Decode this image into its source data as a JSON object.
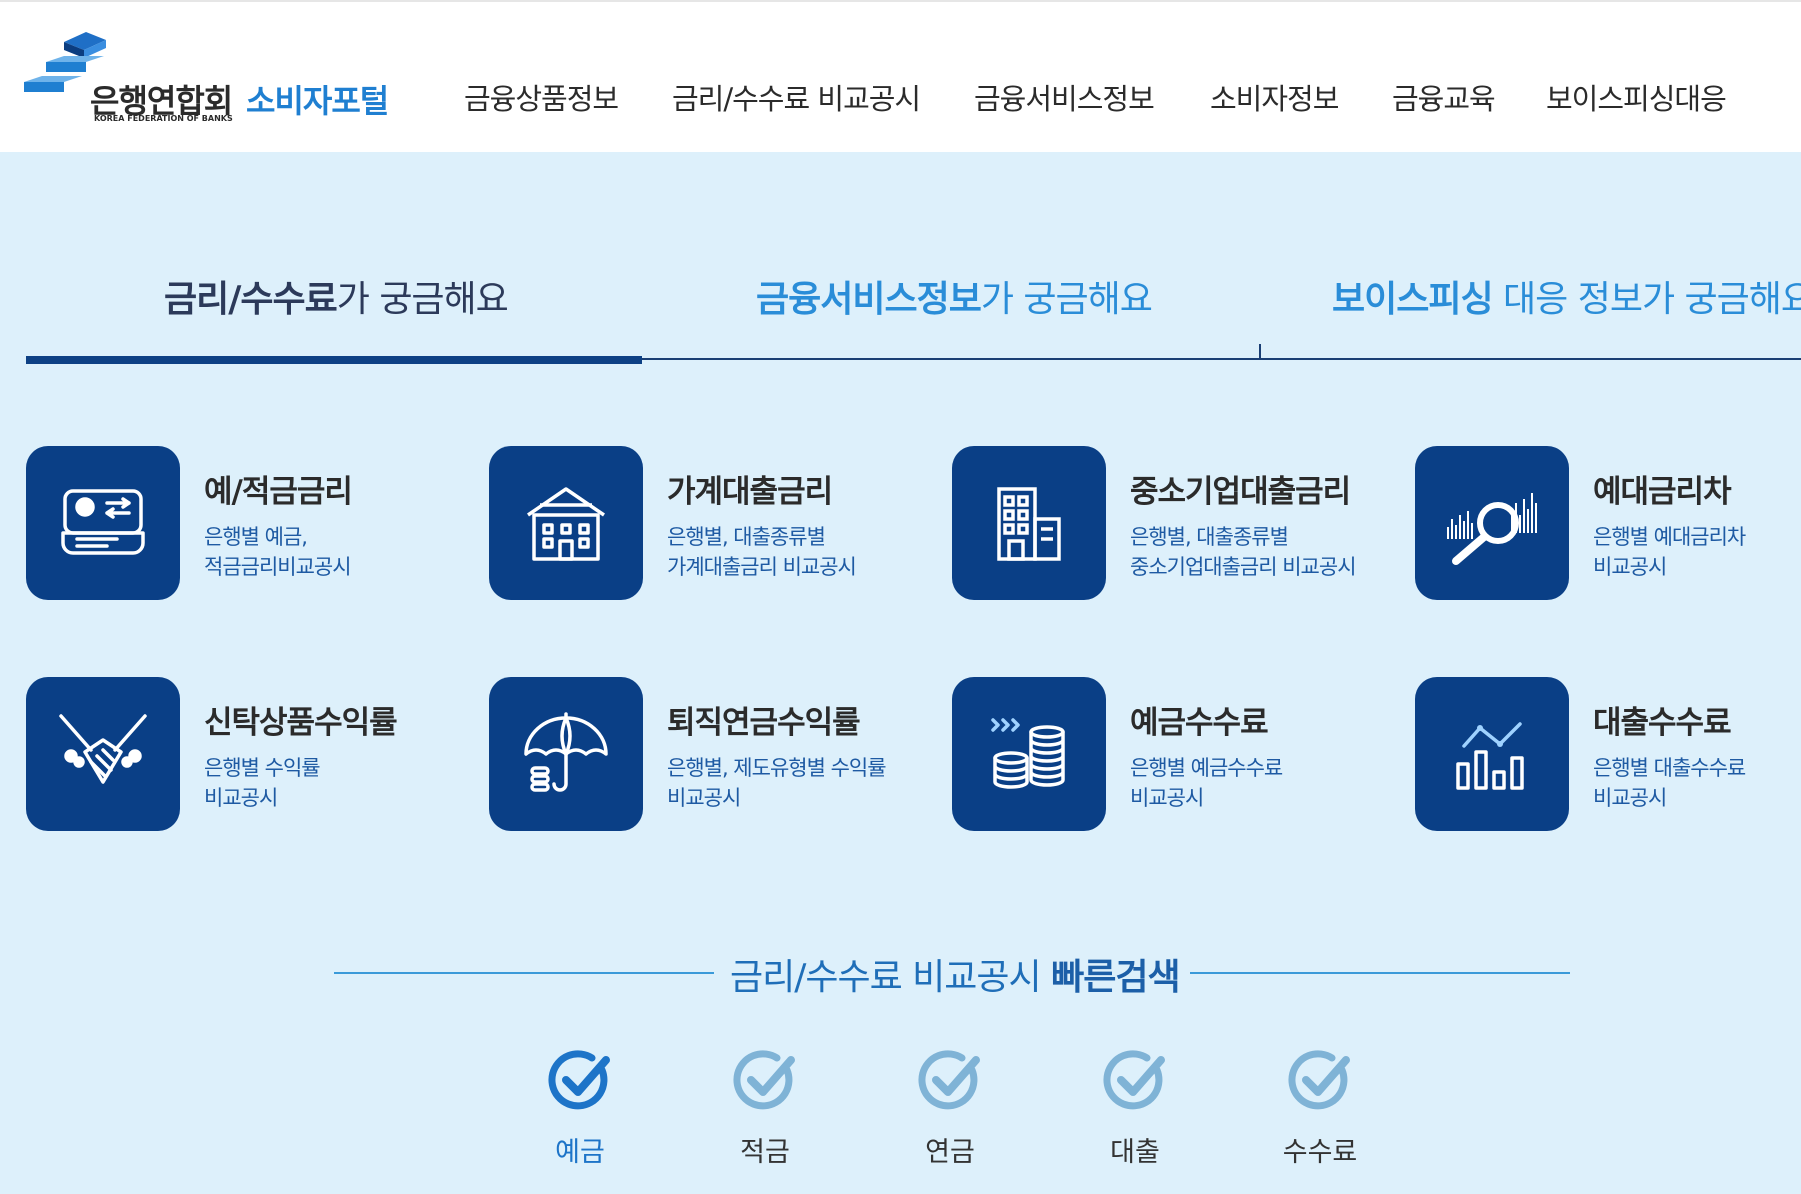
{
  "header": {
    "org_name": "은행연합회",
    "org_name_en": "KOREA FEDERATION OF BANKS",
    "portal_name": "소비자포털",
    "nav": [
      "금융상품정보",
      "금리/수수료 비교공시",
      "금융서비스정보",
      "소비자정보",
      "금융교육",
      "보이스피싱대응"
    ]
  },
  "tabs": [
    {
      "bold": "금리/수수료",
      "rest": "가 궁금해요",
      "active": true
    },
    {
      "bold": "금융서비스정보",
      "rest": "가 궁금해요",
      "active": false
    },
    {
      "bold": "보이스피싱",
      "rest": " 대응 정보가 궁금해요",
      "active": false
    }
  ],
  "cards": [
    {
      "title": "예/적금금리",
      "desc1": "은행별 예금,",
      "desc2": "적금금리비교공시",
      "icon": "savings-card-icon"
    },
    {
      "title": "가계대출금리",
      "desc1": "은행별, 대출종류별",
      "desc2": "가계대출금리 비교공시",
      "icon": "house-icon"
    },
    {
      "title": "중소기업대출금리",
      "desc1": "은행별, 대출종류별",
      "desc2": "중소기업대출금리 비교공시",
      "icon": "building-icon"
    },
    {
      "title": "예대금리차",
      "desc1": "은행별 예대금리차",
      "desc2": "비교공시",
      "icon": "magnifier-chart-icon"
    },
    {
      "title": "신탁상품수익률",
      "desc1": "은행별 수익률",
      "desc2": "비교공시",
      "icon": "handshake-icon"
    },
    {
      "title": "퇴직연금수익률",
      "desc1": "은행별, 제도유형별 수익률",
      "desc2": "비교공시",
      "icon": "umbrella-icon"
    },
    {
      "title": "예금수수료",
      "desc1": "은행별 예금수수료",
      "desc2": "비교공시",
      "icon": "coins-icon"
    },
    {
      "title": "대출수수료",
      "desc1": "은행별 대출수수료",
      "desc2": "비교공시",
      "icon": "bar-chart-icon"
    }
  ],
  "quick_search": {
    "title_normal": "금리/수수료 비교공시 ",
    "title_bold": "빠른검색",
    "items": [
      {
        "label": "예금",
        "active": true
      },
      {
        "label": "적금",
        "active": false
      },
      {
        "label": "연금",
        "active": false
      },
      {
        "label": "대출",
        "active": false
      },
      {
        "label": "수수료",
        "active": false
      }
    ]
  },
  "colors": {
    "brand_navy": "#0a3f86",
    "brand_blue": "#1f7fd1",
    "background": "#ddf0fb",
    "check_active": "#1d74c8",
    "check_inactive": "#7fb3d6"
  }
}
